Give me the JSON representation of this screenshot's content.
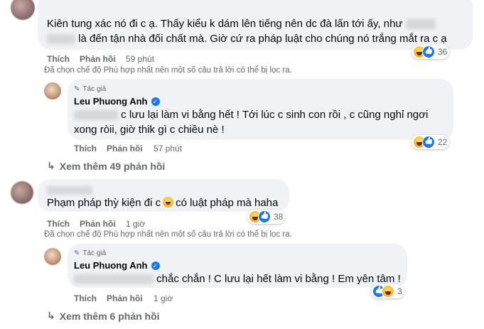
{
  "comment1": {
    "line1": "Kiên tung xác nó đi c ạ. Thấy kiểu k dám lên tiếng nên dc đà lấn tới ấy, như",
    "line2": "là đến tận nhà đối chất mà. Giờ cứ ra pháp luật cho chúng nó trắng mắt ra c ạ",
    "like": "Thích",
    "reply": "Phản hồi",
    "time": "59 phút",
    "reactions": "36",
    "notice": "Đã chọn chế độ Phù hợp nhất nên một số câu trả lời có thể bị lọc ra."
  },
  "reply1": {
    "author_tag": "Tác giả",
    "author_name": "Leu Phuong Anh",
    "line1": "c lưu lại làm vi bằng hết ! Tới lúc c sinh con rồi , c cũng nghỉ ngơi",
    "line2": "xong ròii, giờ thik gì c chiều nè !",
    "like": "Thích",
    "reply": "Phản hồi",
    "time": "57 phút",
    "reactions": "22"
  },
  "more1": "Xem thêm 49 phản hồi",
  "comment2": {
    "line1_a": "Phạm pháp thỳ kiện đi c",
    "line1_b": "có luật pháp mà haha",
    "like": "Thích",
    "reply": "Phản hồi",
    "time": "1 giờ",
    "reactions": "38",
    "notice": "Đã chọn chế độ Phù hợp nhất nên một số câu trả lời có thể bị lọc ra."
  },
  "reply2": {
    "author_tag": "Tác giả",
    "author_name": "Leu Phuong Anh",
    "line1": "chắc chắn ! C lưu lại hết làm vi bằng ! Em yên tâm !",
    "like": "Thích",
    "reply": "Phản hồi",
    "time": "1 giờ",
    "reactions": "3"
  },
  "more2": "Xem thêm 6 phản hồi",
  "icons": {
    "verified": "verified-badge-icon",
    "pencil": "pencil-icon",
    "reply_arrow": "reply-arrow-icon",
    "haha": "haha-reaction-icon",
    "like": "like-reaction-icon"
  },
  "colors": {
    "bubble": "#f0f2f5",
    "secondary_text": "#65676b",
    "verified": "#1877f2"
  }
}
